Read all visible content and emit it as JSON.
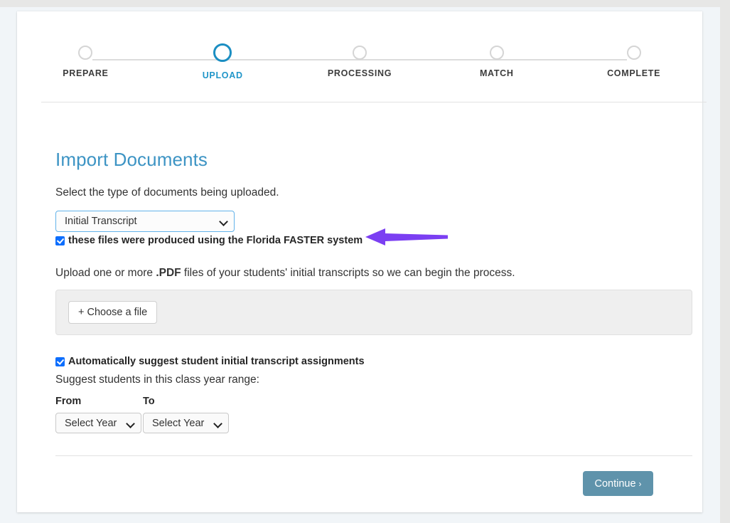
{
  "stepper": {
    "steps": [
      {
        "label": "PREPARE",
        "state": "done"
      },
      {
        "label": "UPLOAD",
        "state": "active"
      },
      {
        "label": "PROCESSING",
        "state": "todo"
      },
      {
        "label": "MATCH",
        "state": "todo"
      },
      {
        "label": "COMPLETE",
        "state": "todo"
      }
    ],
    "active_color": "#2196c9",
    "inactive_color": "#3c3c3c"
  },
  "main": {
    "title": "Import Documents",
    "title_color": "#3d94c4",
    "doc_type_label": "Select the type of documents being uploaded.",
    "doc_type_select": {
      "value": "Initial Transcript",
      "options": [
        "Initial Transcript"
      ]
    },
    "faster_checkbox": {
      "label": "these files were produced using the Florida FASTER system",
      "checked": true
    },
    "upload_instructions_pre": "Upload one or more ",
    "upload_instructions_bold": ".PDF",
    "upload_instructions_post": " files of your students' initial transcripts so we can begin the process.",
    "choose_file_button": "+ Choose a file",
    "autosuggest_checkbox": {
      "label": "Automatically suggest student initial transcript assignments",
      "checked": true
    },
    "suggest_range_text": "Suggest students in this class year range:",
    "from_header": "From",
    "to_header": "To",
    "from_select": {
      "value": "Select Year",
      "options": [
        "Select Year"
      ]
    },
    "to_select": {
      "value": "Select Year",
      "options": [
        "Select Year"
      ]
    },
    "continue_button": {
      "label": "Continue",
      "chevron": "›",
      "color": "#5f93ab"
    }
  },
  "annotation": {
    "arrow_icon": "arrow-left-annotation",
    "color": "#7b3ff2",
    "points_to": "faster-checkbox"
  }
}
